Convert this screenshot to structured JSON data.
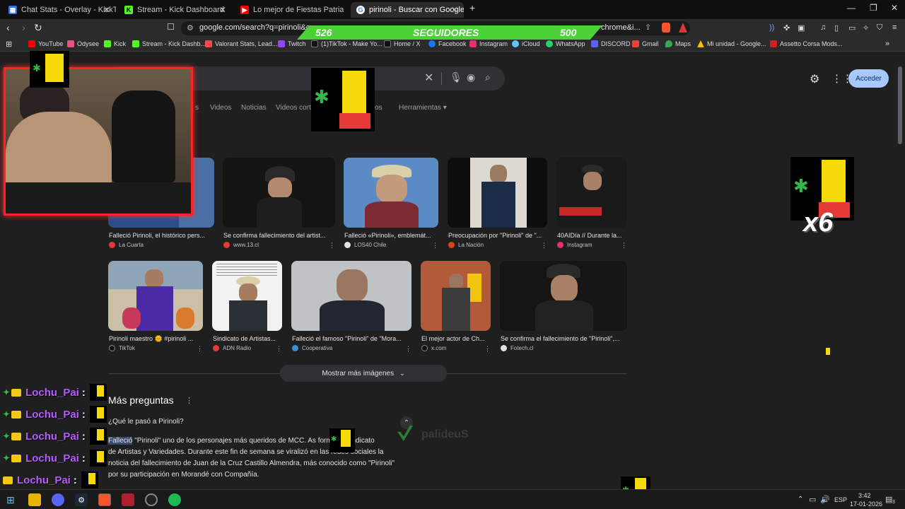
{
  "tabs": [
    {
      "label": "Chat Stats - Overlay - KickTools",
      "color": "#2d6df6",
      "glyph": "▦"
    },
    {
      "label": "Stream - Kick Dashboard",
      "color": "#53fc18",
      "glyph": "K"
    },
    {
      "label": "Lo mejor de Fiestas Patrias - Fabio To",
      "color": "#ff0000",
      "glyph": "▶"
    },
    {
      "label": "pirinoli - Buscar con Google",
      "color": "#ffffff",
      "glyph": "G"
    }
  ],
  "tab_close": "✕",
  "new_tab": "+",
  "window_controls": {
    "minimize": "—",
    "restore": "❐",
    "close": "✕"
  },
  "address": {
    "url": "google.com/search?q=pirinoli&oq=",
    "url_tail": "chrome&i..."
  },
  "bookmarks": [
    {
      "label": "YouTube",
      "color": "#ff0000"
    },
    {
      "label": "Odysee",
      "color": "#e8508a"
    },
    {
      "label": "Kick",
      "color": "#53fc18"
    },
    {
      "label": "Stream - Kick Dashb...",
      "color": "#53fc18"
    },
    {
      "label": "Valorant Stats, Lead...",
      "color": "#ff4655"
    },
    {
      "label": "Twitch",
      "color": "#9146ff"
    },
    {
      "label": "(1)TikTok - Make Yo...",
      "color": "#111111"
    },
    {
      "label": "Home / X",
      "color": "#111111"
    },
    {
      "label": "Facebook",
      "color": "#1877f2"
    },
    {
      "label": "Instagram",
      "color": "#e1306c"
    },
    {
      "label": "iCloud",
      "color": "#5ac8fa"
    },
    {
      "label": "WhatsApp",
      "color": "#25d366"
    },
    {
      "label": "DISCORD",
      "color": "#5865f2"
    },
    {
      "label": "Gmail",
      "color": "#ea4335"
    },
    {
      "label": "Maps",
      "color": "#34a853"
    },
    {
      "label": "Mi unidad - Google...",
      "color": "#fbbc04"
    },
    {
      "label": "Assetto Corsa Mods...",
      "color": "#d02020"
    }
  ],
  "google": {
    "nav": [
      "s",
      "Videos",
      "Noticias",
      "Videos cortos",
      "os",
      "Herramientas ▾"
    ],
    "acceder": "Acceder",
    "more_images": "Mostrar más imágenes",
    "more_questions": "Más preguntas",
    "question": "¿Qué le pasó a Pirinoli?",
    "answer_hl": "Falleció",
    "answer_lines": [
      " \"Pirinoli\" uno de los personajes más queridos de MCC. As    formó el Sindicato",
      "de Artistas y Variedades. Durante este fin de semana se viralizó en las redes sociales la",
      "noticia del fallecimiento de Juan de la Cruz Castillo Almendra, más conocido como \"Pirinoli\"",
      "por su participación en Morandé con Compañía."
    ]
  },
  "images_row1": [
    {
      "caption": "Falleció Pirinoli, el histórico pers...",
      "source": "La Cuarta",
      "src_color": "#e53935"
    },
    {
      "caption": "Se confirma fallecimiento del artist...",
      "source": "www.13.cl",
      "src_color": "#e53935"
    },
    {
      "caption": "Falleció «Pirinoli», emblemát...",
      "source": "LOS40 Chile",
      "src_color": "#e3e3e3"
    },
    {
      "caption": "Preocupación por \"Pirinoli\" de \"...",
      "source": "La Nación",
      "src_color": "#d84315"
    },
    {
      "caption": "40AIDía // Durante la...",
      "source": "Instagram",
      "src_color": "#e1306c"
    }
  ],
  "images_row2": [
    {
      "caption": "Pirinoli maestro 🌞 #pirinoli ...",
      "source": "TikTok",
      "src_color": "#111111"
    },
    {
      "caption": "Sindicato de Artistas...",
      "source": "ADN Radio",
      "src_color": "#e53935"
    },
    {
      "caption": "Falleció el famoso \"Pirinoli\" de \"Mora...",
      "source": "Cooperativa",
      "src_color": "#3b8fd6"
    },
    {
      "caption": "El mejor actor de Ch...",
      "source": "x.com",
      "src_color": "#111111"
    },
    {
      "caption": "Se confirma el fallecimiento de \"Pirinoli\",...",
      "source": "Fotech.cl",
      "src_color": "#e3e3e3"
    }
  ],
  "overlay": {
    "followers_current": "526",
    "followers_label": "SEGUIDORES",
    "followers_goal": "500",
    "followers_progress": 1.0,
    "x6": "x6",
    "watermark": "palideuS"
  },
  "chat": [
    {
      "user": "Lochu_Pai",
      "colon": ":"
    },
    {
      "user": "Lochu_Pai",
      "colon": ":"
    },
    {
      "user": "Lochu_Pai",
      "colon": ":"
    },
    {
      "user": "Lochu_Pai",
      "colon": ":"
    },
    {
      "user": "Lochu_Pai",
      "colon": ":"
    }
  ],
  "taskbar": {
    "lang": "ESP",
    "time": "3:42",
    "date": "17-01-2026",
    "notif": "3"
  }
}
